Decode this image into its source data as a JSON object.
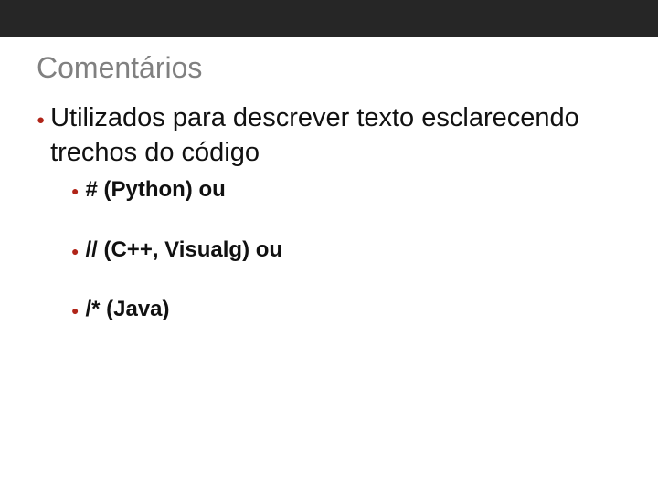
{
  "slide": {
    "title": "Comentários",
    "main_point": "Utilizados para descrever texto esclarecendo trechos do código",
    "sub_points": [
      "# (Python) ou",
      "// (C++, Visualg) ou",
      "/* (Java)"
    ]
  }
}
